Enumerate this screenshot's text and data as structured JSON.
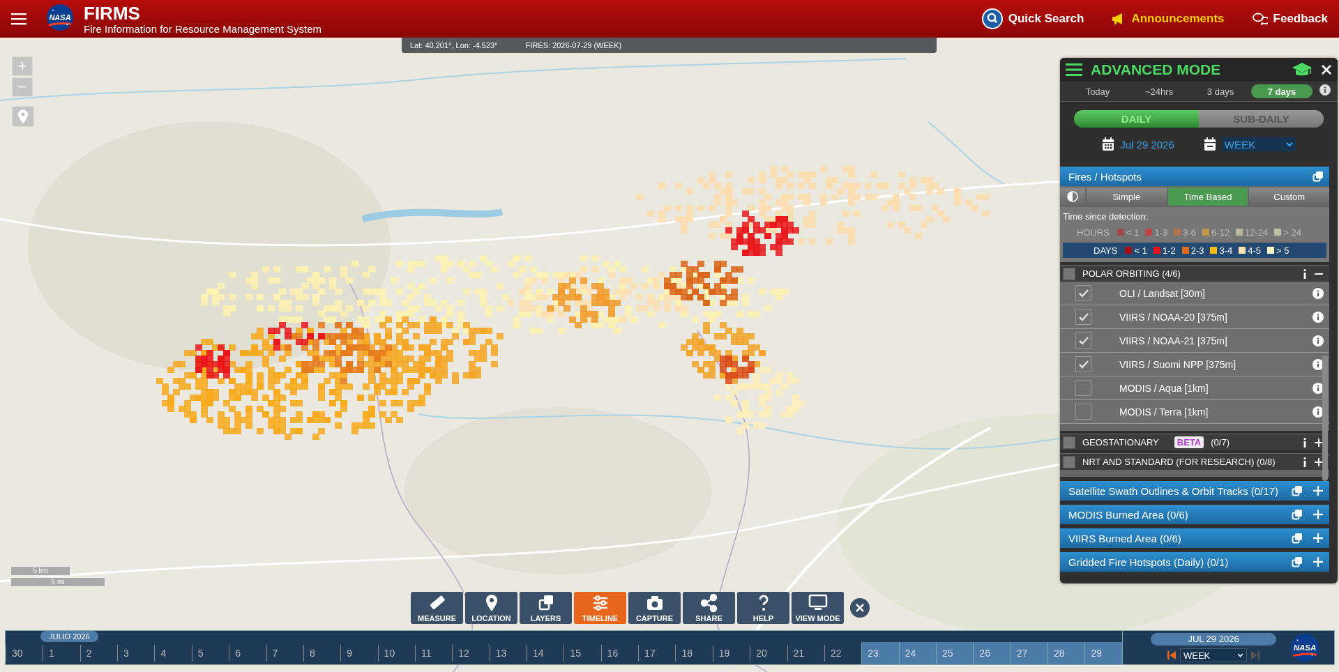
{
  "header": {
    "logo": "NASA",
    "title": "FIRMS",
    "subtitle": "Fire Information for Resource Management System",
    "actions": [
      {
        "label": "Quick Search",
        "kind": "search"
      },
      {
        "label": "Announcements",
        "kind": "announce"
      },
      {
        "label": "Feedback",
        "kind": "feedback"
      }
    ]
  },
  "status_bar": {
    "coordinates": "Lat: 40.201°, Lon: -4.523°",
    "fires": "FIRES: 2026-07-29 (WEEK)"
  },
  "map_controls": {
    "zoom_in": "+",
    "zoom_out": "−",
    "scale": [
      "5 km",
      "5 mi"
    ]
  },
  "panel": {
    "title": "ADVANCED MODE",
    "ranges": [
      {
        "label": "Today",
        "selected": false
      },
      {
        "label": "~24hrs",
        "selected": false
      },
      {
        "label": "3 days",
        "selected": false
      },
      {
        "label": "7 days",
        "selected": true
      }
    ],
    "modes": [
      {
        "label": "DAILY",
        "selected": true
      },
      {
        "label": "SUB-DAILY",
        "selected": false
      }
    ],
    "date": "Jul 29 2026",
    "period": "WEEK",
    "fires": {
      "title": "Fires / Hotspots",
      "styles": [
        {
          "label": "Simple",
          "selected": false
        },
        {
          "label": "Time Based",
          "selected": true
        },
        {
          "label": "Custom",
          "selected": false
        }
      ],
      "legend_title": "Time since detection:",
      "legend": [
        {
          "label": "HOURS",
          "selected": false,
          "items": [
            {
              "label": "< 1",
              "color": "#9e4a4a"
            },
            {
              "label": "1-3",
              "color": "#c04848"
            },
            {
              "label": "3-6",
              "color": "#b0754c"
            },
            {
              "label": "6-12",
              "color": "#bf9a48"
            },
            {
              "label": "12-24",
              "color": "#bfb69e"
            },
            {
              "label": "> 24",
              "color": "#bdbfa3"
            }
          ]
        },
        {
          "label": "DAYS",
          "selected": true,
          "items": [
            {
              "label": "< 1",
              "color": "#a50f15"
            },
            {
              "label": "1-2",
              "color": "#e8161b"
            },
            {
              "label": "2-3",
              "color": "#e8690f"
            },
            {
              "label": "3-4",
              "color": "#fbb913"
            },
            {
              "label": "4-5",
              "color": "#fde4b4"
            },
            {
              "label": "> 5",
              "color": "#fefbc4"
            }
          ]
        }
      ]
    },
    "groups": [
      {
        "title": "POLAR ORBITING (4/6)",
        "checked": false,
        "expanded": true,
        "children": [
          {
            "label": "OLI / Landsat [30m]",
            "checked": true
          },
          {
            "label": "VIIRS / NOAA-20 [375m]",
            "checked": true
          },
          {
            "label": "VIIRS / NOAA-21 [375m]",
            "checked": true
          },
          {
            "label": "VIIRS / Suomi NPP [375m]",
            "checked": true
          },
          {
            "label": "MODIS / Aqua [1km]",
            "checked": false
          },
          {
            "label": "MODIS / Terra [1km]",
            "checked": false
          }
        ]
      },
      {
        "title": "GEOSTATIONARY",
        "badge": "BETA",
        "count": "(0/7)",
        "checked": false,
        "expanded": false
      },
      {
        "title": "NRT AND STANDARD (FOR RESEARCH) (0/8)",
        "checked": false,
        "expanded": false
      }
    ],
    "layers": [
      {
        "title": "Satellite Swath Outlines & Orbit Tracks (0/17)",
        "expanded": false
      },
      {
        "title": "MODIS Burned Area (0/6)",
        "expanded": false
      },
      {
        "title": "VIIRS Burned Area (0/6)",
        "expanded": false
      },
      {
        "title": "Gridded Fire Hotspots (Daily) (0/1)",
        "expanded": false
      }
    ]
  },
  "toolbar": [
    {
      "label": "MEASURE",
      "kind": "ruler",
      "selected": false
    },
    {
      "label": "LOCATION",
      "kind": "pin",
      "selected": false
    },
    {
      "label": "LAYERS",
      "kind": "layers",
      "selected": false
    },
    {
      "label": "TIMELINE",
      "kind": "sliders",
      "selected": true
    },
    {
      "label": "CAPTURE",
      "kind": "camera",
      "selected": false
    },
    {
      "label": "SHARE",
      "kind": "share",
      "selected": false
    },
    {
      "label": "HELP",
      "kind": "help",
      "selected": false
    },
    {
      "label": "VIEW MODE",
      "kind": "monitor",
      "selected": false
    }
  ],
  "timeline": {
    "month": "JULIO 2026",
    "date": "JUL 29 2026",
    "period": "WEEK",
    "logo": "NASA",
    "days": [
      {
        "label": "30",
        "selected": false
      },
      {
        "label": "1",
        "selected": false
      },
      {
        "label": "2",
        "selected": false
      },
      {
        "label": "3",
        "selected": false
      },
      {
        "label": "4",
        "selected": false
      },
      {
        "label": "5",
        "selected": false
      },
      {
        "label": "6",
        "selected": false
      },
      {
        "label": "7",
        "selected": false
      },
      {
        "label": "8",
        "selected": false
      },
      {
        "label": "9",
        "selected": false
      },
      {
        "label": "10",
        "selected": false
      },
      {
        "label": "11",
        "selected": false
      },
      {
        "label": "12",
        "selected": false
      },
      {
        "label": "13",
        "selected": false
      },
      {
        "label": "14",
        "selected": false
      },
      {
        "label": "15",
        "selected": false
      },
      {
        "label": "16",
        "selected": false
      },
      {
        "label": "17",
        "selected": false
      },
      {
        "label": "18",
        "selected": false
      },
      {
        "label": "19",
        "selected": false
      },
      {
        "label": "20",
        "selected": false
      },
      {
        "label": "21",
        "selected": false
      },
      {
        "label": "22",
        "selected": false
      },
      {
        "label": "23",
        "selected": true
      },
      {
        "label": "24",
        "selected": true
      },
      {
        "label": "25",
        "selected": true
      },
      {
        "label": "26",
        "selected": true
      },
      {
        "label": "27",
        "selected": true
      },
      {
        "label": "28",
        "selected": true
      },
      {
        "label": "29",
        "selected": true
      }
    ]
  }
}
